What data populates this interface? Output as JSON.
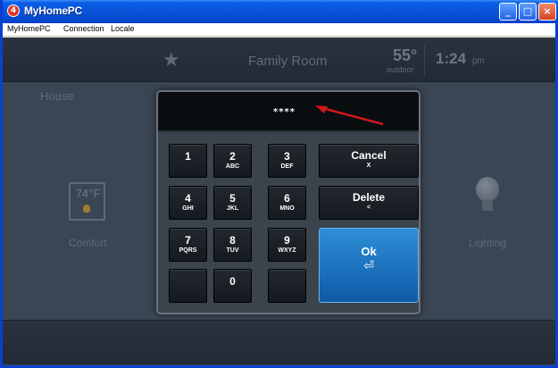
{
  "window": {
    "title": "MyHomePC",
    "app_icon_glyph": "4"
  },
  "titlebar_buttons": {
    "minimize": "_",
    "maximize": "□",
    "close": "×"
  },
  "menu": [
    "MyHomePC",
    "Connection",
    "Locale"
  ],
  "header": {
    "star": "★",
    "room": "Family Room",
    "temp": "55°",
    "temp_label": "outdoor",
    "time": "1:24",
    "ampm": "pm"
  },
  "house_label": "House",
  "comfort": {
    "temp": "74°F",
    "label": "Comfort"
  },
  "lighting": {
    "label": "Lighting"
  },
  "keypad": {
    "display": "****",
    "keys": [
      {
        "num": "1",
        "sub": ""
      },
      {
        "num": "2",
        "sub": "ABC"
      },
      {
        "num": "3",
        "sub": "DEF"
      },
      {
        "num": "4",
        "sub": "GHI"
      },
      {
        "num": "5",
        "sub": "JKL"
      },
      {
        "num": "6",
        "sub": "MNO"
      },
      {
        "num": "7",
        "sub": "PQRS"
      },
      {
        "num": "8",
        "sub": "TUV"
      },
      {
        "num": "9",
        "sub": "WXYZ"
      },
      {
        "num": "0",
        "sub": ""
      }
    ],
    "cancel": {
      "label": "Cancel",
      "sub": "X"
    },
    "delete": {
      "label": "Delete",
      "sub": "<"
    },
    "ok": {
      "label": "Ok",
      "sub": "⏎"
    }
  },
  "colors": {
    "accent": "#1a76c4",
    "annotation_arrow": "#d0171c"
  }
}
